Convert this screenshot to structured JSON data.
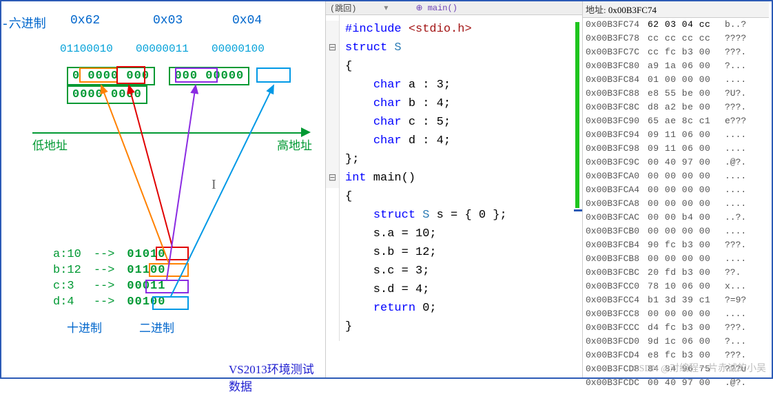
{
  "left": {
    "hex_label": "-六进制",
    "hex": [
      "0x62",
      "0x03",
      "0x04"
    ],
    "bin": [
      "01100010",
      "00000011",
      "00000100"
    ],
    "bytes": [
      "0 0000 000",
      "000 00000",
      "0000 0000"
    ],
    "axis_low": "低地址",
    "axis_high": "高地址",
    "assignments": [
      {
        "name": "a:10",
        "arrow": "-->",
        "bin": "01010"
      },
      {
        "name": "b:12",
        "arrow": "-->",
        "bin": "01100"
      },
      {
        "name": "c:3",
        "arrow": "-->",
        "bin": "00011"
      },
      {
        "name": "d:4",
        "arrow": "-->",
        "bin": "00100"
      }
    ],
    "dec_lbl": "十进制",
    "bin_lbl": "二进制",
    "footer": "VS2013环境测试数据"
  },
  "code": {
    "dropdown_left": "(跳回)",
    "dropdown_right": "main()",
    "lines": [
      "#include <stdio.h>",
      "struct S",
      "{",
      "    char a : 3;",
      "    char b : 4;",
      "    char c : 5;",
      "    char d : 4;",
      "};",
      "int main()",
      "{",
      "    struct S s = { 0 };",
      "    s.a = 10;",
      "    s.b = 12;",
      "    s.c = 3;",
      "    s.d = 4;",
      "    return 0;",
      "}"
    ]
  },
  "memory": {
    "hdr_label": "地址:",
    "hdr_addr": "0x00B3FC74",
    "rows": [
      {
        "a": "0x00B3FC74",
        "b": "62 03 04 cc",
        "t": "b..?"
      },
      {
        "a": "0x00B3FC78",
        "b": "cc cc cc cc",
        "t": "????"
      },
      {
        "a": "0x00B3FC7C",
        "b": "cc fc b3 00",
        "t": "???."
      },
      {
        "a": "0x00B3FC80",
        "b": "a9 1a 06 00",
        "t": "?..."
      },
      {
        "a": "0x00B3FC84",
        "b": "01 00 00 00",
        "t": "...."
      },
      {
        "a": "0x00B3FC88",
        "b": "e8 55 be 00",
        "t": "?U?."
      },
      {
        "a": "0x00B3FC8C",
        "b": "d8 a2 be 00",
        "t": "???."
      },
      {
        "a": "0x00B3FC90",
        "b": "65 ae 8c c1",
        "t": "e???"
      },
      {
        "a": "0x00B3FC94",
        "b": "09 11 06 00",
        "t": "...."
      },
      {
        "a": "0x00B3FC98",
        "b": "09 11 06 00",
        "t": "...."
      },
      {
        "a": "0x00B3FC9C",
        "b": "00 40 97 00",
        "t": ".@?."
      },
      {
        "a": "0x00B3FCA0",
        "b": "00 00 00 00",
        "t": "...."
      },
      {
        "a": "0x00B3FCA4",
        "b": "00 00 00 00",
        "t": "...."
      },
      {
        "a": "0x00B3FCA8",
        "b": "00 00 00 00",
        "t": "...."
      },
      {
        "a": "0x00B3FCAC",
        "b": "00 00 b4 00",
        "t": "..?."
      },
      {
        "a": "0x00B3FCB0",
        "b": "00 00 00 00",
        "t": "...."
      },
      {
        "a": "0x00B3FCB4",
        "b": "90 fc b3 00",
        "t": "???."
      },
      {
        "a": "0x00B3FCB8",
        "b": "00 00 00 00",
        "t": "...."
      },
      {
        "a": "0x00B3FCBC",
        "b": "20 fd b3 00",
        "t": " ??."
      },
      {
        "a": "0x00B3FCC0",
        "b": "78 10 06 00",
        "t": "x..."
      },
      {
        "a": "0x00B3FCC4",
        "b": "b1 3d 39 c1",
        "t": "?=9?"
      },
      {
        "a": "0x00B3FCC8",
        "b": "00 00 00 00",
        "t": "...."
      },
      {
        "a": "0x00B3FCCC",
        "b": "d4 fc b3 00",
        "t": "???."
      },
      {
        "a": "0x00B3FCD0",
        "b": "9d 1c 06 00",
        "t": "?..."
      },
      {
        "a": "0x00B3FCD4",
        "b": "e8 fc b3 00",
        "t": "???."
      },
      {
        "a": "0x00B3FCD8",
        "b": "84 84 96 75",
        "t": "???u"
      },
      {
        "a": "0x00B3FCDC",
        "b": "00 40 97 00",
        "t": ".@?."
      }
    ]
  },
  "watermark": "CSDN @对编程一片赤诚的小吴"
}
